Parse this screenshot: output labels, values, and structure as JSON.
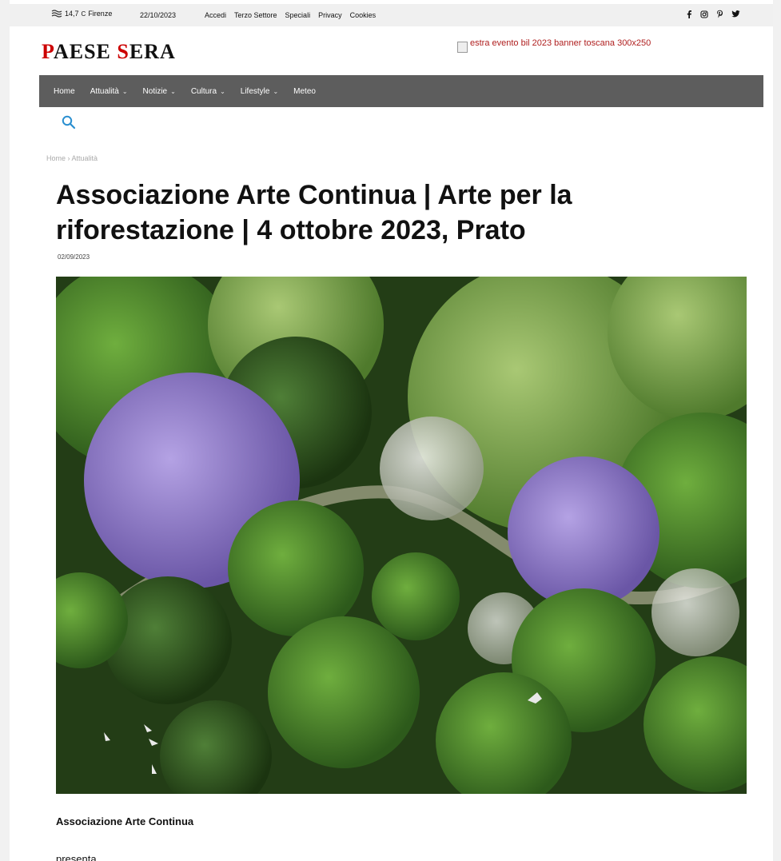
{
  "topbar": {
    "temperature": "14,7",
    "unit": "C",
    "city": "Firenze",
    "date": "22/10/2023",
    "links": [
      "Accedi",
      "Terzo Settore",
      "Speciali",
      "Privacy",
      "Cookies"
    ]
  },
  "logo": {
    "part1_first": "P",
    "part1_rest": "AESE ",
    "part2_first": "S",
    "part2_rest": "ERA"
  },
  "banner": {
    "alt": "estra evento bil 2023 banner toscana 300x250"
  },
  "nav": {
    "items": [
      {
        "label": "Home",
        "dropdown": false
      },
      {
        "label": "Attualità",
        "dropdown": true
      },
      {
        "label": "Notizie",
        "dropdown": true
      },
      {
        "label": "Cultura",
        "dropdown": true
      },
      {
        "label": "Lifestyle",
        "dropdown": true
      },
      {
        "label": "Meteo",
        "dropdown": false
      }
    ],
    "dropdown_glyph": "⌄"
  },
  "breadcrumb": {
    "home": "Home",
    "separator": "›",
    "current": "Attualità"
  },
  "article": {
    "title": " Associazione Arte Continua | Arte per la riforestazione | 4 ottobre 2023, Prato",
    "date": "02/09/2023",
    "paragraph1": "Associazione Arte Continua",
    "paragraph2": "presenta"
  },
  "colors": {
    "nav_bg": "#5d5d5d",
    "accent_red": "#c00000",
    "search_icon": "#2a8fd0"
  },
  "icons": {
    "weather": "wind-icon",
    "search": "search-icon",
    "social": [
      "facebook-icon",
      "instagram-icon",
      "pinterest-icon",
      "twitter-icon"
    ]
  }
}
